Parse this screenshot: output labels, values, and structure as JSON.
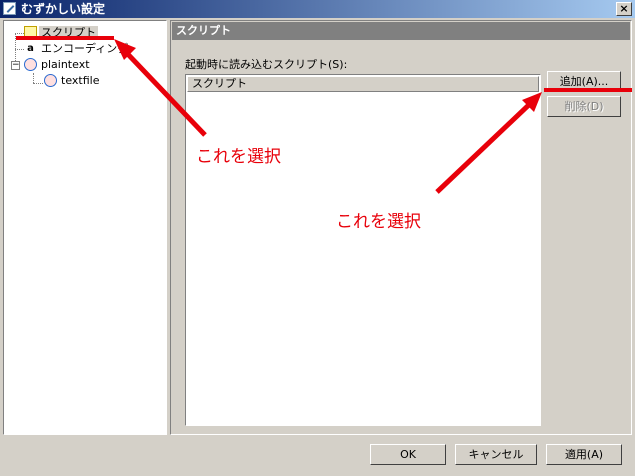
{
  "window": {
    "title": "むずかしい設定",
    "close_glyph": "×"
  },
  "tree": {
    "items": [
      {
        "label": "スクリプト",
        "icon": "script-icon"
      },
      {
        "label": "エンコーディング",
        "icon": "encoding-icon"
      },
      {
        "label": "plaintext",
        "icon": "plugin-icon"
      },
      {
        "label": "textfile",
        "icon": "plugin-icon"
      }
    ],
    "expander_glyph": "−"
  },
  "content": {
    "header": "スクリプト",
    "list_caption": "起動時に読み込むスクリプト(S):",
    "list_column": "スクリプト",
    "add_button": "追加(A)...",
    "delete_button": "削除(D)"
  },
  "footer": {
    "ok": "OK",
    "cancel": "キャンセル",
    "apply": "適用(A)"
  },
  "annotations": {
    "label1": "これを選択",
    "label2": "これを選択",
    "color": "#e8000a"
  }
}
